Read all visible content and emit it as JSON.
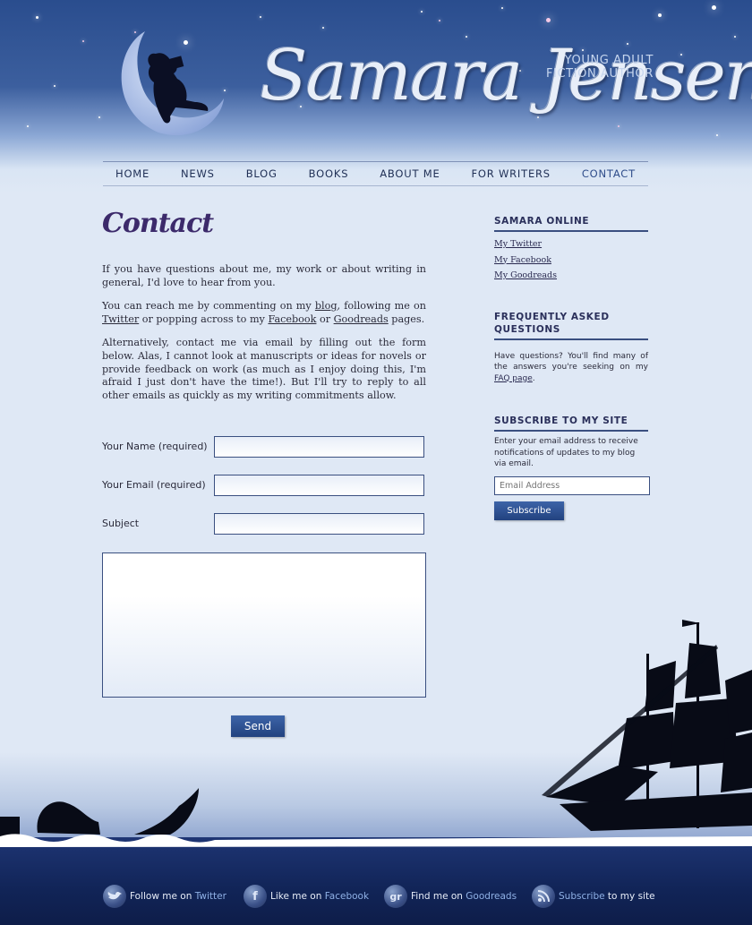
{
  "header": {
    "logo_name": "Samara Jensen",
    "tagline_line1": "YOUNG ADULT",
    "tagline_line2": "FICTION AUTHOR"
  },
  "nav": {
    "items": [
      "HOME",
      "NEWS",
      "BLOG",
      "BOOKS",
      "ABOUT ME",
      "FOR WRITERS",
      "CONTACT"
    ],
    "active": "CONTACT"
  },
  "main": {
    "title": "Contact",
    "para1": "If you have questions about me, my work or about writing in general, I'd love to hear from you.",
    "para2": {
      "t1": "You can reach me by commenting on my ",
      "link_blog": "blog",
      "t2": ", following me on ",
      "link_twitter": "Twitter",
      "t3": " or popping across to my ",
      "link_facebook": "Facebook",
      "t4": " or ",
      "link_goodreads": "Goodreads",
      "t5": " pages."
    },
    "para3": "Alternatively, contact me via email by filling out the form below. Alas, I cannot look at manuscripts or ideas for novels or provide feedback on work (as much as I enjoy doing this, I'm afraid I just don't have the time!). But I'll try to reply to all other emails as quickly as my writing commitments allow."
  },
  "form": {
    "name_label": "Your Name (required)",
    "name_value": "",
    "email_label": "Your Email (required)",
    "email_value": "",
    "subject_label": "Subject",
    "subject_value": "",
    "message_value": "",
    "send_label": "Send"
  },
  "sidebar": {
    "online_heading": "SAMARA ONLINE",
    "online_links": [
      "My Twitter",
      "My Facebook",
      "My Goodreads"
    ],
    "faq_heading_line1": "FREQUENTLY ASKED",
    "faq_heading_line2": "QUESTIONS",
    "faq_text": "Have questions? You'll find many of the answers you're seeking on my ",
    "faq_link": "FAQ page",
    "faq_end": ".",
    "subscribe_heading": "SUBSCRIBE TO MY SITE",
    "subscribe_text": "Enter your email address to receive notifications of updates to my blog via email.",
    "subscribe_placeholder": "Email Address",
    "subscribe_button": "Subscribe"
  },
  "footer": {
    "items": [
      {
        "icon": "twitter-bird-icon",
        "glyph": "",
        "pre": "Follow me on ",
        "hl": "Twitter",
        "post": ""
      },
      {
        "icon": "facebook-icon",
        "glyph": "f",
        "pre": "Like me on ",
        "hl": "Facebook",
        "post": ""
      },
      {
        "icon": "goodreads-icon",
        "glyph": "gr",
        "pre": "Find me on ",
        "hl": "Goodreads",
        "post": ""
      },
      {
        "icon": "rss-icon",
        "glyph": "",
        "pre": "",
        "hl": "Subscribe",
        "post": " to my site"
      }
    ]
  },
  "colors": {
    "sky_top": "#2a4d8e",
    "page_bg": "#dfe8f5",
    "ocean": "#112457",
    "button": "#2f528f",
    "heading": "#2a2f5a"
  }
}
